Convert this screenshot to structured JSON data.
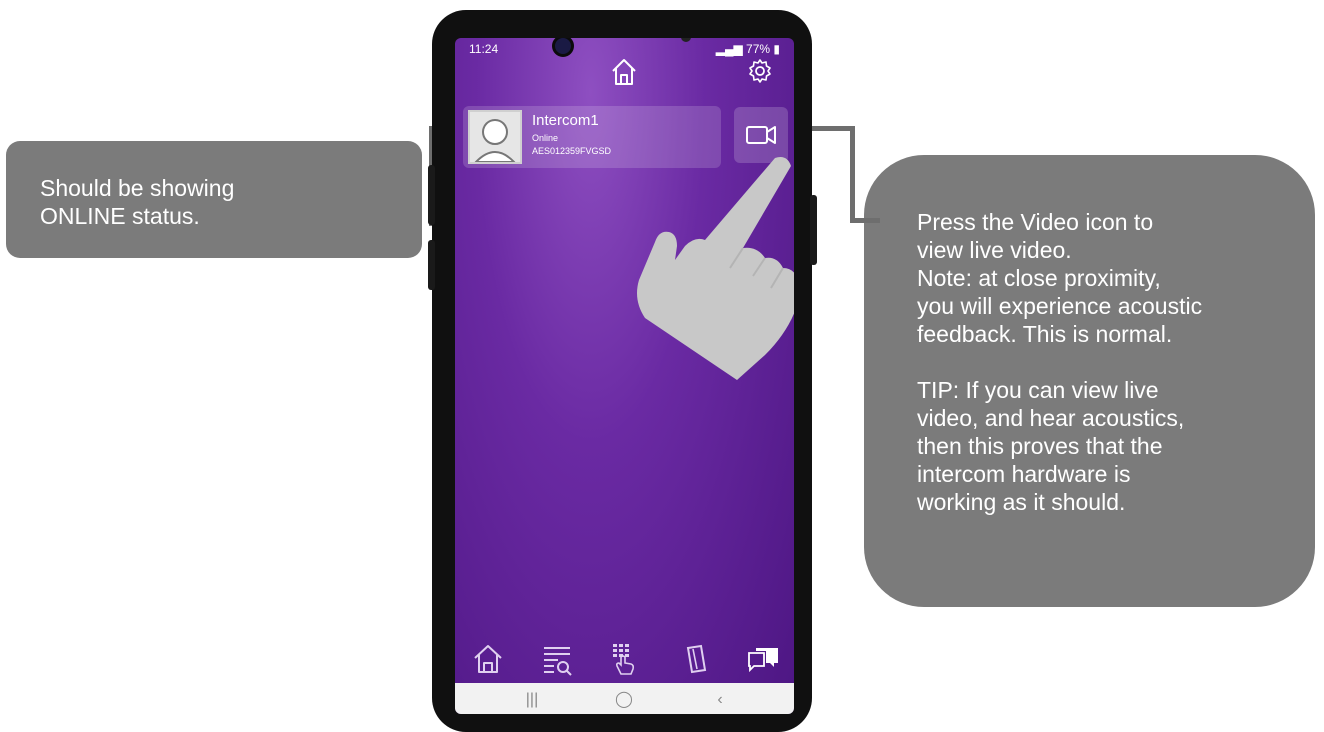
{
  "status_bar": {
    "time": "11:24",
    "battery": "77%"
  },
  "device": {
    "name": "Intercom1",
    "status": "Online",
    "serial": "AES012359FVGSD"
  },
  "callouts": {
    "left": [
      "Should be showing",
      "ONLINE status."
    ],
    "right_p1": [
      "Press the Video icon to",
      "view live video.",
      "Note: at close proximity,",
      "you will experience acoustic",
      "feedback. This is normal."
    ],
    "right_p2": [
      "TIP: If you can view live",
      "video, and hear acoustics,",
      "then this proves that the",
      "intercom hardware is",
      "working as it should."
    ]
  },
  "icons": {
    "top_bar": [
      "home-icon",
      "gear-icon"
    ],
    "card": [
      "avatar-icon",
      "video-camera-icon"
    ],
    "tab_bar": [
      "home-icon",
      "list-search-icon",
      "keypad-touch-icon",
      "card-icon",
      "chat-icon"
    ],
    "nav_bar": [
      "recents-icon",
      "home-circle-icon",
      "back-icon"
    ]
  },
  "colors": {
    "screen_purple": "#6a2aa3",
    "callout_gray": "#7b7b7b",
    "hand_gray": "#c8c8c8"
  }
}
